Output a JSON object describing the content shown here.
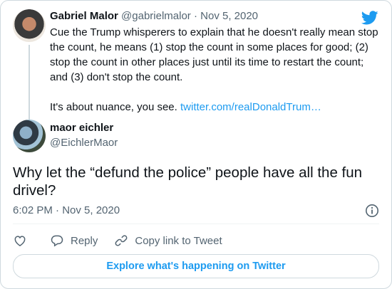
{
  "parent_tweet": {
    "author_name": "Gabriel Malor",
    "author_handle": "@gabrielmalor",
    "separator": "·",
    "date": "Nov 5, 2020",
    "paragraph1": "Cue the Trump whisperers to explain that he doesn't really mean stop the count, he means (1) stop the count in some places for good; (2) stop the count in other places just until its time to restart the count; and (3) don't stop the count.",
    "paragraph2_text": "It's about nuance, you see.",
    "link_text": "twitter.com/realDonaldTrum…"
  },
  "main_tweet": {
    "author_name": "maor eichler",
    "author_handle": "@EichlerMaor",
    "text": "Why let the “defund the police” people have all the fun drivel?",
    "timestamp": "6:02 PM · Nov 5, 2020"
  },
  "actions": {
    "reply_label": "Reply",
    "copy_link_label": "Copy link to Tweet"
  },
  "explore_button_label": "Explore what's happening on Twitter",
  "icons": {
    "logo": "twitter-bird-icon",
    "like": "heart-icon",
    "reply": "speech-bubble-icon",
    "copy": "link-icon",
    "info": "info-icon"
  },
  "colors": {
    "accent": "#1d9bf0",
    "text": "#0f1419",
    "muted": "#536471",
    "border": "#cfd9de"
  }
}
